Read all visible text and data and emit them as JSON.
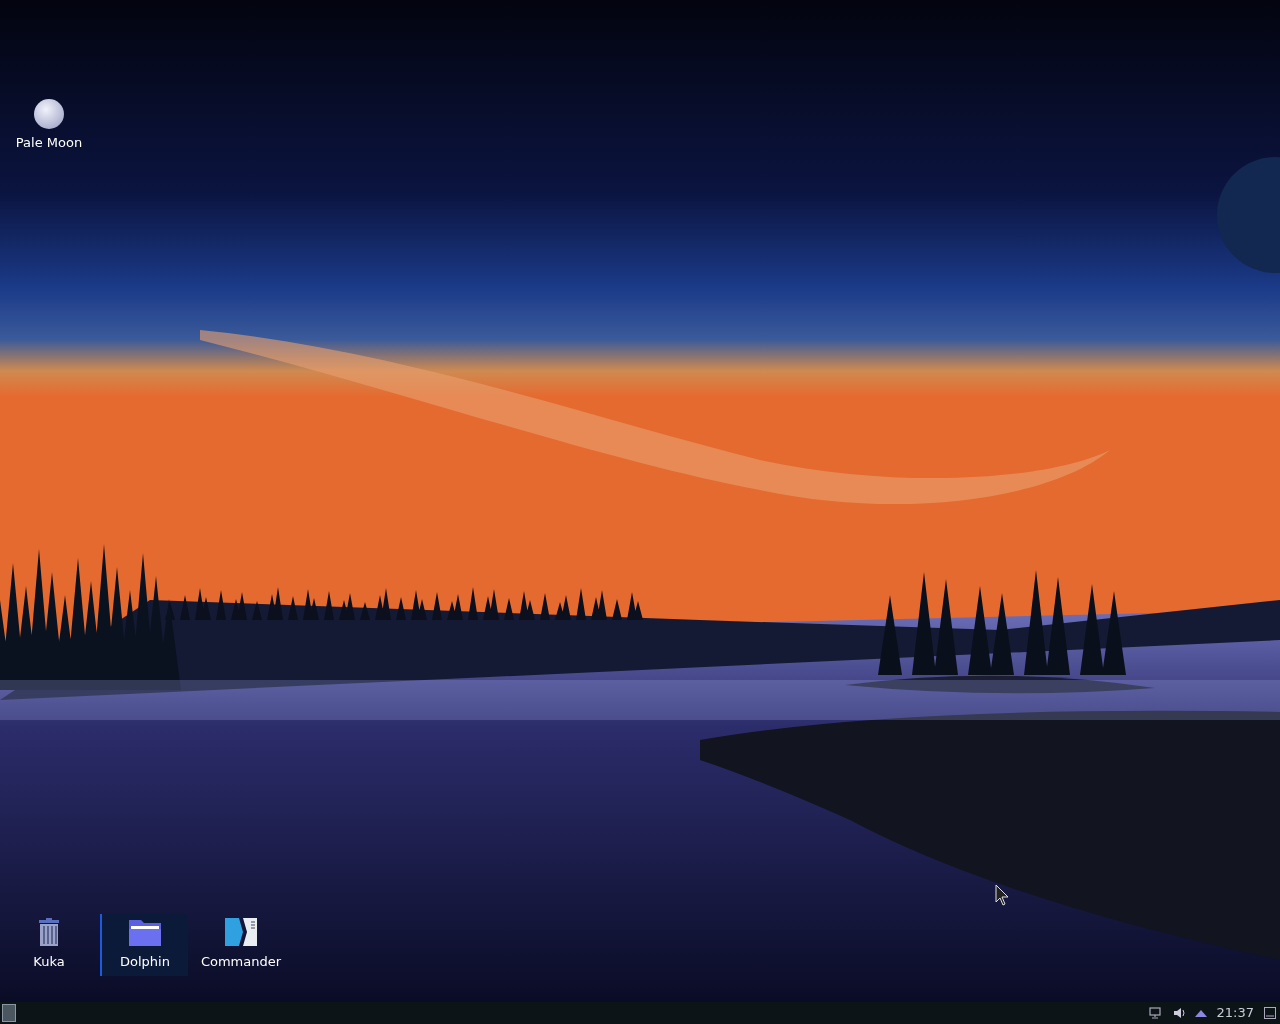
{
  "desktop_icons": [
    {
      "label": "Pale Moon"
    }
  ],
  "dock": {
    "items": [
      {
        "label": "Kuka",
        "kind": "trash",
        "selected": false
      },
      {
        "label": "Dolphin",
        "kind": "folder",
        "selected": true
      },
      {
        "label": "Commander",
        "kind": "commander",
        "selected": false
      }
    ]
  },
  "taskbar": {
    "clock": "21:37"
  }
}
